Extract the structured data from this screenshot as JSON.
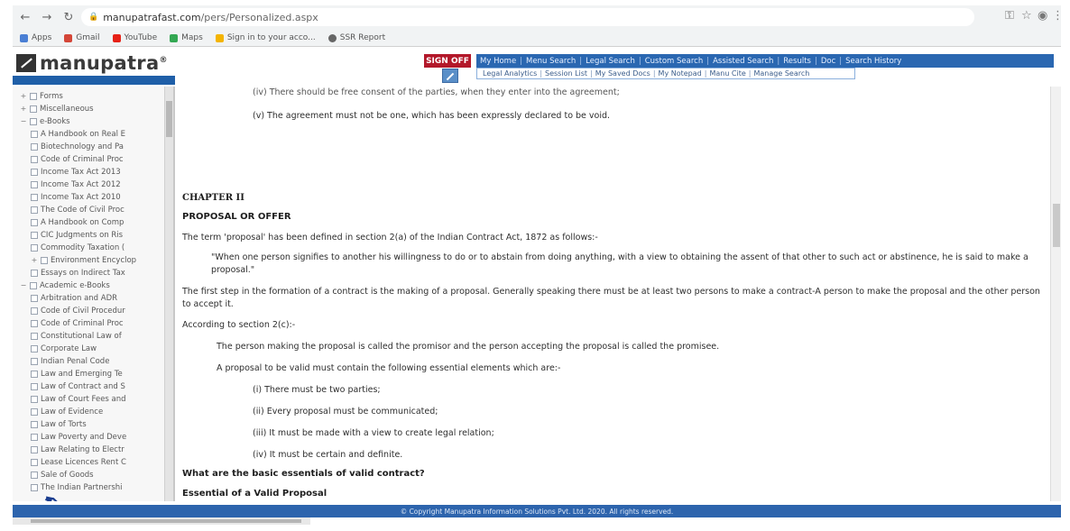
{
  "browser": {
    "url_host": "manupatrafast.com",
    "url_path": "/pers/Personalized.aspx",
    "bookmarks": [
      {
        "label": "Apps",
        "color": "#4a7fd4"
      },
      {
        "label": "Gmail",
        "color": "#d44638"
      },
      {
        "label": "YouTube",
        "color": "#e62117"
      },
      {
        "label": "Maps",
        "color": "#34a853"
      },
      {
        "label": "Sign in to your acco...",
        "color": "#f4b400"
      },
      {
        "label": "SSR Report",
        "color": "#666666"
      }
    ]
  },
  "site": {
    "logo_text": "manupatra",
    "logo_reg": "®",
    "signoff_label": "SIGN OFF",
    "topnav": [
      "My Home",
      "Menu Search",
      "Legal Search",
      "Custom Search",
      "Assisted Search",
      "Results",
      "Doc",
      "Search History"
    ],
    "subnav": [
      "Legal Analytics",
      "Session List",
      "My Saved Docs",
      "My Notepad",
      "Manu Cite",
      "Manage Search"
    ]
  },
  "tree": {
    "items": [
      {
        "label": "Forms",
        "level": 0,
        "pm": "+"
      },
      {
        "label": "Miscellaneous",
        "level": 0,
        "pm": "+"
      },
      {
        "label": "e-Books",
        "level": 0,
        "pm": "−"
      },
      {
        "label": "A Handbook on Real E",
        "level": 1,
        "pm": ""
      },
      {
        "label": "Biotechnology and Pa",
        "level": 1,
        "pm": ""
      },
      {
        "label": "Code of Criminal Proc",
        "level": 1,
        "pm": ""
      },
      {
        "label": "Income Tax Act 2013",
        "level": 1,
        "pm": ""
      },
      {
        "label": "Income Tax Act 2012",
        "level": 1,
        "pm": ""
      },
      {
        "label": "Income Tax Act 2010",
        "level": 1,
        "pm": ""
      },
      {
        "label": "The Code of Civil Proc",
        "level": 1,
        "pm": ""
      },
      {
        "label": "A Handbook on Comp",
        "level": 1,
        "pm": ""
      },
      {
        "label": "CIC Judgments on Ris",
        "level": 1,
        "pm": ""
      },
      {
        "label": "Commodity Taxation (",
        "level": 1,
        "pm": ""
      },
      {
        "label": "Environment Encyclop",
        "level": 1,
        "pm": "+"
      },
      {
        "label": "Essays on Indirect Tax",
        "level": 1,
        "pm": ""
      },
      {
        "label": "Academic e-Books",
        "level": 0,
        "pm": "−"
      },
      {
        "label": "Arbitration and ADR",
        "level": 1,
        "pm": ""
      },
      {
        "label": "Code of Civil Procedur",
        "level": 1,
        "pm": ""
      },
      {
        "label": "Code of Criminal Proc",
        "level": 1,
        "pm": ""
      },
      {
        "label": "Constitutional Law of",
        "level": 1,
        "pm": ""
      },
      {
        "label": "Corporate Law",
        "level": 1,
        "pm": ""
      },
      {
        "label": "Indian Penal Code",
        "level": 1,
        "pm": ""
      },
      {
        "label": "Law and Emerging Te",
        "level": 1,
        "pm": ""
      },
      {
        "label": "Law of Contract and S",
        "level": 1,
        "pm": ""
      },
      {
        "label": "Law of Court Fees and",
        "level": 1,
        "pm": ""
      },
      {
        "label": "Law of Evidence",
        "level": 1,
        "pm": ""
      },
      {
        "label": "Law of Torts",
        "level": 1,
        "pm": ""
      },
      {
        "label": "Law Poverty and Deve",
        "level": 1,
        "pm": ""
      },
      {
        "label": "Law Relating to Electr",
        "level": 1,
        "pm": ""
      },
      {
        "label": "Lease Licences Rent C",
        "level": 1,
        "pm": ""
      },
      {
        "label": "Sale of Goods",
        "level": 1,
        "pm": ""
      },
      {
        "label": "The Indian Partnershi",
        "level": 1,
        "pm": ""
      }
    ]
  },
  "content": {
    "line_iv_cut": "(iv) There should be free consent of the parties, when they enter into the agreement;",
    "line_v": "(v) The agreement must not be one, which has been expressly declared to be void.",
    "chapter": "CHAPTER II",
    "heading": "PROPOSAL OR OFFER",
    "intro": "The term 'proposal' has been defined in section 2(a) of the Indian Contract Act, 1872 as follows:-",
    "quote": "\"When one person signifies to another his willingness to do or to abstain from doing anything, with a view to obtaining the assent of that other to such act or abstinence, he is said to make a proposal.\"",
    "first_step": "The first step in the formation of a contract is the making of a proposal. Generally speaking there must be at least two persons to make a contract-A person to make the proposal and the other person to accept it.",
    "according": "According to section 2(c):-",
    "promisor": "The person making the proposal is called the promisor and the person accepting the proposal is called the promisee.",
    "valid": "A proposal to be valid must contain the following essential elements which are:-",
    "elements": [
      "(i) There must be two parties;",
      "(ii) Every proposal must be communicated;",
      "(iii) It must be made with a view to create legal relation;",
      "(iv) It must be certain and definite."
    ],
    "question": "What are the basic essentials of valid contract?",
    "essential": "Essential of a Valid Proposal"
  },
  "footer": {
    "copyright": "© Copyright Manupatra Information Solutions Pvt. Ltd. 2020. All rights reserved."
  }
}
